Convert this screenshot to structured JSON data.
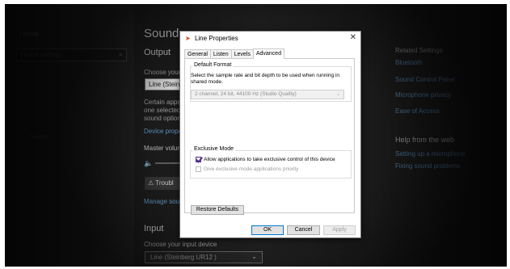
{
  "settings": {
    "left": {
      "home": "Home",
      "search_placeholder": "Find a setting",
      "nav_item": "Sound"
    },
    "main": {
      "title": "Sound",
      "output_heading": "Output",
      "choose_output": "Choose your",
      "output_device": "Line (Steinb",
      "certain_line1": "Certain apps",
      "certain_line2": "one selected",
      "certain_line3": "sound option",
      "device_props_link": "Device prope",
      "master_volume": "Master volur",
      "troubleshoot": "Troubl",
      "manage_link": "Manage sou",
      "input_heading": "Input",
      "choose_input": "Choose your input device",
      "input_device": "Line (Steinberg UR12 )"
    },
    "right": {
      "related": "Related Settings",
      "links": [
        "Bluetooth",
        "Sound Control Panel",
        "Microphone privacy",
        "Ease of Access"
      ],
      "help_heading": "Help from the web",
      "help_links": [
        "Setting up a microphone",
        "Fixing sound problems"
      ]
    }
  },
  "dialog": {
    "title": "Line Properties",
    "close_glyph": "✕",
    "tabs": [
      "General",
      "Listen",
      "Levels",
      "Advanced"
    ],
    "active_tab": "Advanced",
    "default_format": {
      "heading": "Default Format",
      "description": "Select the sample rate and bit depth to be used when running in shared mode.",
      "selected": "2 channel, 24 bit, 44100 Hz (Studio Quality)"
    },
    "exclusive_mode": {
      "heading": "Exclusive Mode",
      "allow_label": "Allow applications to take exclusive control of this device",
      "allow_checked": true,
      "priority_label": "Give exclusive mode applications priority",
      "priority_checked": false
    },
    "buttons": {
      "restore": "Restore Defaults",
      "ok": "OK",
      "cancel": "Cancel",
      "apply": "Apply"
    }
  }
}
